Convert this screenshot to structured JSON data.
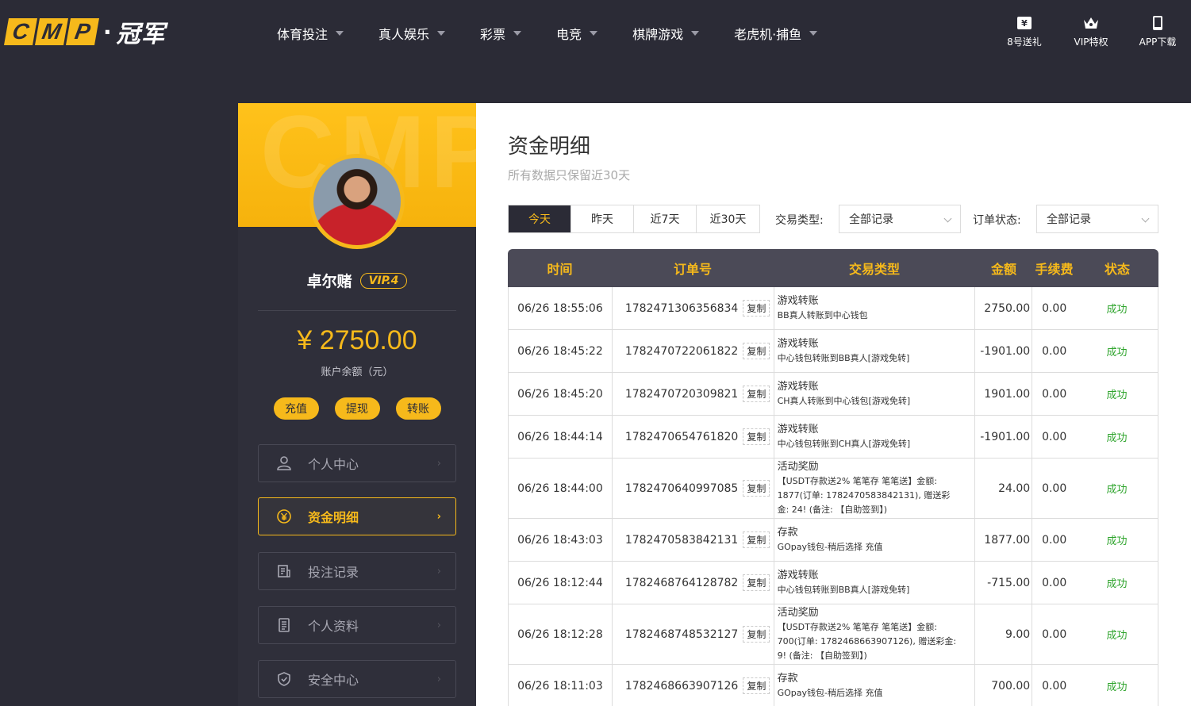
{
  "header": {
    "logo_letters": [
      "C",
      "M",
      "P"
    ],
    "logo_dot": "·",
    "logo_cn": "冠军",
    "nav": [
      {
        "label": "体育投注"
      },
      {
        "label": "真人娱乐"
      },
      {
        "label": "彩票"
      },
      {
        "label": "电竞"
      },
      {
        "label": "棋牌游戏"
      },
      {
        "label": "老虎机·捕鱼"
      }
    ],
    "icons": [
      {
        "label": "8号送礼",
        "icon": "gift-ticket-icon"
      },
      {
        "label": "VIP特权",
        "icon": "crown-icon"
      },
      {
        "label": "APP下载",
        "icon": "phone-icon"
      }
    ]
  },
  "sidebar": {
    "watermark": "CMP",
    "username": "卓尔赌",
    "vip": "VIP.4",
    "balance": "¥ 2750.00",
    "balance_label": "账户余额（元）",
    "actions": [
      "充值",
      "提现",
      "转账"
    ],
    "menu": [
      {
        "label": "个人中心",
        "icon": "user-icon",
        "active": false
      },
      {
        "label": "资金明细",
        "icon": "yen-circle-icon",
        "active": true
      },
      {
        "label": "投注记录",
        "icon": "bet-record-icon",
        "active": false
      },
      {
        "label": "个人资料",
        "icon": "profile-doc-icon",
        "active": false
      },
      {
        "label": "安全中心",
        "icon": "shield-icon",
        "active": false
      }
    ],
    "arrow": "›"
  },
  "main": {
    "title": "资金明细",
    "subtitle": "所有数据只保留近30天",
    "tabs": [
      "今天",
      "昨天",
      "近7天",
      "近30天"
    ],
    "filters": {
      "type_label": "交易类型:",
      "type_value": "全部记录",
      "status_label": "订单状态:",
      "status_value": "全部记录"
    },
    "columns": [
      "时间",
      "订单号",
      "交易类型",
      "金额",
      "手续费",
      "状态"
    ],
    "copy_label": "复制",
    "rows": [
      {
        "time": "06/26 18:55:06",
        "order": "1782471306356834",
        "type": "游戏转账",
        "desc": [
          "BB真人转账到中心钱包"
        ],
        "amount": "2750.00",
        "fee": "0.00",
        "status": "成功"
      },
      {
        "time": "06/26 18:45:22",
        "order": "1782470722061822",
        "type": "游戏转账",
        "desc": [
          "中心钱包转账到BB真人[游戏免转]"
        ],
        "amount": "-1901.00",
        "fee": "0.00",
        "status": "成功"
      },
      {
        "time": "06/26 18:45:20",
        "order": "1782470720309821",
        "type": "游戏转账",
        "desc": [
          "CH真人转账到中心钱包[游戏免转]"
        ],
        "amount": "1901.00",
        "fee": "0.00",
        "status": "成功"
      },
      {
        "time": "06/26 18:44:14",
        "order": "1782470654761820",
        "type": "游戏转账",
        "desc": [
          "中心钱包转账到CH真人[游戏免转]"
        ],
        "amount": "-1901.00",
        "fee": "0.00",
        "status": "成功"
      },
      {
        "time": "06/26 18:44:00",
        "order": "1782470640997085",
        "type": "活动奖励",
        "desc": [
          "【USDT存款送2% 笔笔存 笔笔送】金额:",
          "1877(订单: 1782470583842131), 赠送彩",
          "金: 24! (备注: 【自助签到】)"
        ],
        "amount": "24.00",
        "fee": "0.00",
        "status": "成功"
      },
      {
        "time": "06/26 18:43:03",
        "order": "1782470583842131",
        "type": "存款",
        "desc": [
          "GOpay钱包-稍后选择 充值"
        ],
        "amount": "1877.00",
        "fee": "0.00",
        "status": "成功"
      },
      {
        "time": "06/26 18:12:44",
        "order": "1782468764128782",
        "type": "游戏转账",
        "desc": [
          "中心钱包转账到BB真人[游戏免转]"
        ],
        "amount": "-715.00",
        "fee": "0.00",
        "status": "成功"
      },
      {
        "time": "06/26 18:12:28",
        "order": "1782468748532127",
        "type": "活动奖励",
        "desc": [
          "【USDT存款送2% 笔笔存 笔笔送】金额:",
          "700(订单: 1782468663907126), 赠送彩金:",
          "9! (备注: 【自助签到】)"
        ],
        "amount": "9.00",
        "fee": "0.00",
        "status": "成功"
      },
      {
        "time": "06/26 18:11:03",
        "order": "1782468663907126",
        "type": "存款",
        "desc": [
          "GOpay钱包-稍后选择 充值"
        ],
        "amount": "700.00",
        "fee": "0.00",
        "status": "成功"
      }
    ]
  }
}
